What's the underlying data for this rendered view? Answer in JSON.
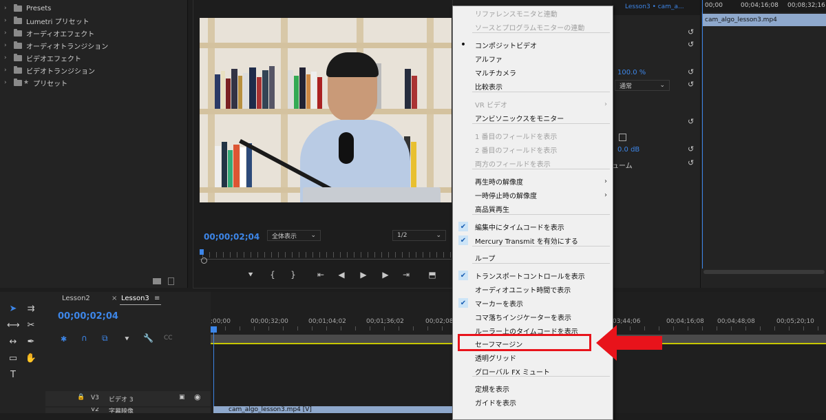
{
  "effects_panel": {
    "items": [
      {
        "label": "Presets",
        "star": false
      },
      {
        "label": "Lumetri プリセット",
        "star": false
      },
      {
        "label": "オーディオエフェクト",
        "star": false
      },
      {
        "label": "オーディオトランジション",
        "star": false
      },
      {
        "label": "ビデオエフェクト",
        "star": false
      },
      {
        "label": "ビデオトランジション",
        "star": false
      },
      {
        "label": "プリセット",
        "star": true
      }
    ]
  },
  "monitor": {
    "timecode": "00;00;02;04",
    "fit_select": "全体表示",
    "resolution_select": "1/2"
  },
  "menu": {
    "items": [
      {
        "label": "リファレンスモニタと連動",
        "disabled": true,
        "mark": "",
        "submenu": false
      },
      {
        "label": "ソースとプログラムモニターの連動",
        "disabled": true,
        "mark": "",
        "submenu": false
      },
      {
        "label": "コンポジットビデオ",
        "disabled": false,
        "mark": "dot",
        "submenu": false
      },
      {
        "label": "アルファ",
        "disabled": false,
        "mark": "",
        "submenu": false
      },
      {
        "label": "マルチカメラ",
        "disabled": false,
        "mark": "",
        "submenu": false
      },
      {
        "label": "比較表示",
        "disabled": false,
        "mark": "",
        "submenu": false
      },
      {
        "label": "VR ビデオ",
        "disabled": true,
        "mark": "",
        "submenu": true
      },
      {
        "label": "アンビソニックスをモニター",
        "disabled": false,
        "mark": "",
        "submenu": false
      },
      {
        "label": "1 番目のフィールドを表示",
        "disabled": true,
        "mark": "",
        "submenu": false
      },
      {
        "label": "2 番目のフィールドを表示",
        "disabled": true,
        "mark": "",
        "submenu": false
      },
      {
        "label": "両方のフィールドを表示",
        "disabled": true,
        "mark": "",
        "submenu": false
      },
      {
        "label": "再生時の解像度",
        "disabled": false,
        "mark": "",
        "submenu": true
      },
      {
        "label": "一時停止時の解像度",
        "disabled": false,
        "mark": "",
        "submenu": true
      },
      {
        "label": "高品質再生",
        "disabled": false,
        "mark": "",
        "submenu": false
      },
      {
        "label": "編集中にタイムコードを表示",
        "disabled": false,
        "mark": "check",
        "submenu": false
      },
      {
        "label": "Mercury Transmit を有効にする",
        "disabled": false,
        "mark": "check",
        "submenu": false
      },
      {
        "label": "ループ",
        "disabled": false,
        "mark": "",
        "submenu": false
      },
      {
        "label": "トランスポートコントロールを表示",
        "disabled": false,
        "mark": "check",
        "submenu": false
      },
      {
        "label": "オーディオユニット時間で表示",
        "disabled": false,
        "mark": "",
        "submenu": false
      },
      {
        "label": "マーカーを表示",
        "disabled": false,
        "mark": "check",
        "submenu": false
      },
      {
        "label": "コマ落ちインジケーターを表示",
        "disabled": false,
        "mark": "",
        "submenu": false
      },
      {
        "label": "ルーラー上のタイムコードを表示",
        "disabled": false,
        "mark": "",
        "submenu": false
      },
      {
        "label": "セーフマージン",
        "disabled": false,
        "mark": "",
        "submenu": false
      },
      {
        "label": "透明グリッド",
        "disabled": false,
        "mark": "",
        "submenu": false
      },
      {
        "label": "グローバル FX ミュート",
        "disabled": false,
        "mark": "",
        "submenu": false
      },
      {
        "label": "定規を表示",
        "disabled": false,
        "mark": "",
        "submenu": false
      },
      {
        "label": "ガイドを表示",
        "disabled": false,
        "mark": "",
        "submenu": false
      }
    ]
  },
  "effect_controls": {
    "sequence_tab": "Lesson3 • cam_a...",
    "opacity_value": "100.0 %",
    "blend_mode": "通常",
    "volume_value": "0.0 dB",
    "partial_label": "ューム"
  },
  "source_panel": {
    "ruler_labels": [
      "00;00",
      "00;04;16;08",
      "00;08;32;16"
    ],
    "clip_name": "cam_algo_lesson3.mp4"
  },
  "timeline": {
    "tabs": [
      "Lesson2",
      "Lesson3"
    ],
    "timecode": "00;00;02;04",
    "ruler_labels": [
      ";00;00",
      "00;00;32;00",
      "00;01;04;02",
      "00;01;36;02",
      "00;02;08",
      "03;44;06",
      "00;04;16;08",
      "00;04;48;08",
      "00;05;20;10"
    ],
    "tracks": [
      {
        "id": "V3",
        "name": "ビデオ 3"
      },
      {
        "id": "V2",
        "name": "字幕映像"
      }
    ],
    "clip_name": "cam_algo_lesson3.mp4 [V]"
  },
  "colors": {
    "accent_blue": "#3d86e8",
    "highlight_red": "#e8131b",
    "menu_bg": "#f0f0f0",
    "panel_bg": "#232323"
  }
}
